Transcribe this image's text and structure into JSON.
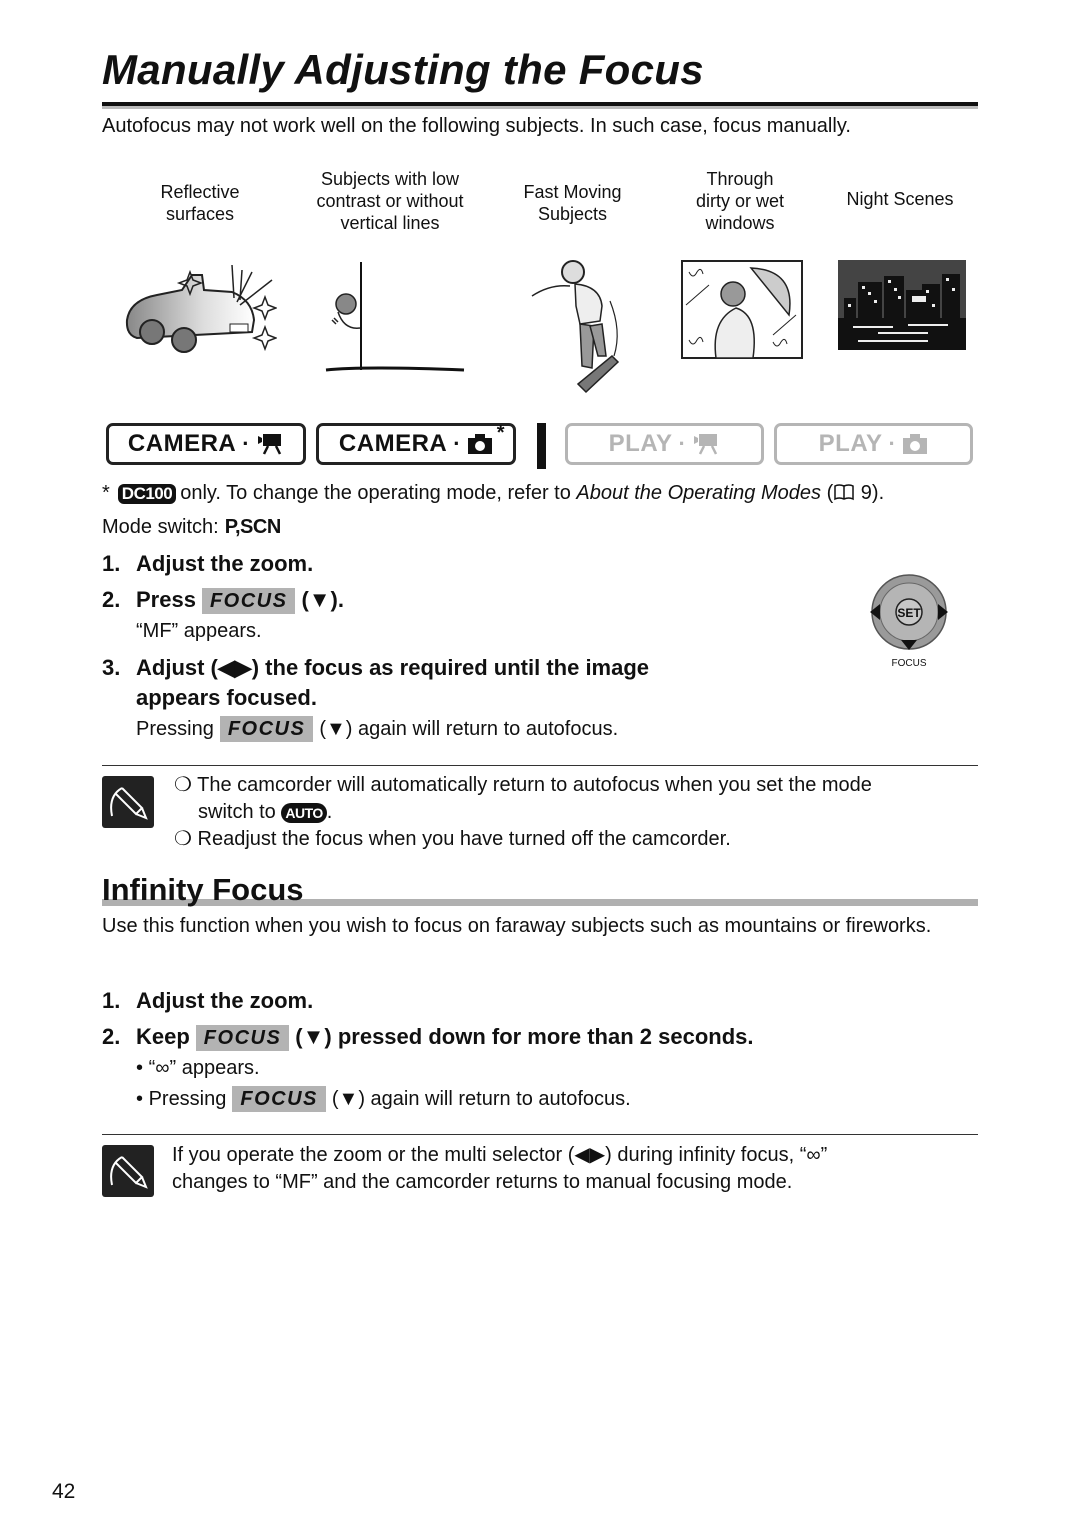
{
  "page": {
    "title": "Manually Adjusting the Focus",
    "intro": "Autofocus may not work well on the following subjects. In such case, focus manually.",
    "page_number": "42"
  },
  "subjects": [
    {
      "label_lines": [
        "Reflective",
        "surfaces"
      ],
      "illustration": "car-reflection-illustration"
    },
    {
      "label_lines": [
        "Subjects with low",
        "contrast or without",
        "vertical lines"
      ],
      "illustration": "person-behind-wall-illustration"
    },
    {
      "label_lines": [
        "Fast Moving",
        "Subjects"
      ],
      "illustration": "snowboarder-illustration"
    },
    {
      "label_lines": [
        "Through",
        "dirty or wet",
        "windows"
      ],
      "illustration": "rainy-window-illustration"
    },
    {
      "label_lines": [
        "Night Scenes"
      ],
      "illustration": "night-city-illustration"
    }
  ],
  "modes": [
    {
      "label": "CAMERA",
      "icon": "movie-camera-icon",
      "active": true,
      "star": ""
    },
    {
      "label": "CAMERA",
      "icon": "still-camera-icon",
      "active": true,
      "star": "*"
    },
    {
      "label": "PLAY",
      "icon": "movie-camera-icon",
      "active": false,
      "star": ""
    },
    {
      "label": "PLAY",
      "icon": "still-camera-icon",
      "active": false,
      "star": ""
    }
  ],
  "footnote": {
    "star": "*",
    "badge": "DC100",
    "text_before": "only. To change the operating mode, refer to ",
    "link_text": "About the Operating Modes",
    "text_after_open": " (",
    "book_icon": "book-icon",
    "page_ref": " 9)."
  },
  "mode_switch": {
    "label": "Mode switch:",
    "value": "P,SCN"
  },
  "manual_steps": {
    "s1": {
      "num": "1.",
      "text": "Adjust the zoom."
    },
    "s2": {
      "num": "2.",
      "pre": "Press",
      "key": "FOCUS",
      "post": "(▼).",
      "sub": "“MF” appears."
    },
    "s3": {
      "num": "3.",
      "line1_pre": "Adjust (",
      "arrows": "◀▶",
      "line1_post": ") the focus as required until the image",
      "line2": "appears focused.",
      "sub_pre": "Pressing",
      "sub_key": "FOCUS",
      "sub_post": "(▼) again will return to autofocus."
    }
  },
  "controller": {
    "center_label": "SET",
    "bottom_label": "FOCUS"
  },
  "note1": {
    "bullet": "❍",
    "item1_line1": "The camcorder will automatically return to autofocus when you set the mode",
    "item1_line2_pre": "switch to",
    "item1_badge": "AUTO",
    "item1_line2_post": ".",
    "item2": "Readjust the focus when you have turned off the camcorder."
  },
  "infinity": {
    "title": "Infinity Focus",
    "intro": "Use this function when you wish to focus on faraway subjects such as mountains or fireworks.",
    "s1": {
      "num": "1.",
      "text": "Adjust the zoom."
    },
    "s2": {
      "num": "2.",
      "pre": "Keep",
      "key": "FOCUS",
      "post": "(▼) pressed down for more than 2 seconds."
    },
    "bullets": [
      {
        "pre": "“∞” appears.",
        "key": "",
        "post": ""
      },
      {
        "pre": "Pressing",
        "key": "FOCUS",
        "post": "(▼) again will return to autofocus."
      }
    ]
  },
  "note2": {
    "line1": "If you operate the zoom or the multi selector (◀▶) during infinity focus, “∞”",
    "line2": "changes to “MF” and the camcorder returns to manual focusing mode."
  }
}
